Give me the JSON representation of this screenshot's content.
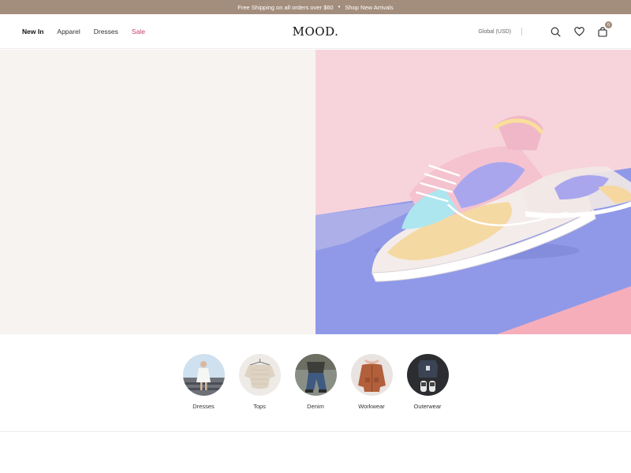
{
  "announcement": {
    "text": "Free Shipping on all orders over $60",
    "separator": "•",
    "link": "Shop New Arrivals"
  },
  "nav": {
    "items": [
      {
        "label": "New In",
        "active": true
      },
      {
        "label": "Apparel"
      },
      {
        "label": "Dresses"
      },
      {
        "label": "Sale",
        "accent": "#c0406a"
      }
    ]
  },
  "brand": {
    "logo": "MOOD."
  },
  "tools": {
    "region": "Global (USD)",
    "icons": [
      "search-icon",
      "heart-icon",
      "shopping-bag-icon"
    ],
    "cart_count": "0"
  },
  "hero": {
    "left_color": "#f7f3f1",
    "image": "pastel sneaker on pink and blue background"
  },
  "categories": [
    {
      "label": "Dresses",
      "image": "person in white dress on steps"
    },
    {
      "label": "Tops",
      "image": "cream knit top on hanger"
    },
    {
      "label": "Denim",
      "image": "person in jeans sitting"
    },
    {
      "label": "Workwear",
      "image": "rust brown jacket"
    },
    {
      "label": "Outerwear",
      "image": "dark jacket and sneakers flat lay"
    }
  ],
  "colors": {
    "announcement_bg": "#a38d7c",
    "sale": "#c0406a"
  }
}
